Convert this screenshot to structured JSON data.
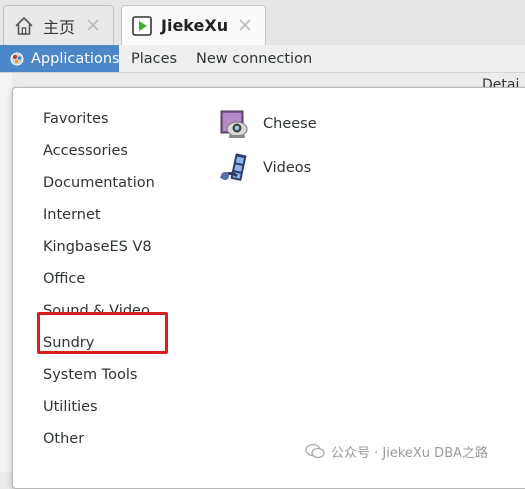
{
  "tabs": [
    {
      "label": "主页",
      "icon": "home-icon",
      "active": false
    },
    {
      "label": "JiekeXu",
      "icon": "terminal-play-icon",
      "active": true
    }
  ],
  "menubar": {
    "applications": "Applications",
    "places": "Places",
    "new_connection": "New connection"
  },
  "background": {
    "detail_fragment": "Detai"
  },
  "categories": [
    "Favorites",
    "Accessories",
    "Documentation",
    "Internet",
    "KingbaseES V8",
    "Office",
    "Sound & Video",
    "Sundry",
    "System Tools",
    "Utilities",
    "Other"
  ],
  "highlighted_category": "KingbaseES V8",
  "apps": [
    {
      "label": "Cheese",
      "icon": "webcam-icon"
    },
    {
      "label": "Videos",
      "icon": "film-reel-icon"
    }
  ],
  "watermark": "公众号 · JiekeXu DBA之路",
  "colors": {
    "accent": "#4a86c8",
    "highlight_box": "#d62020",
    "active_tab": "#fafafa"
  }
}
